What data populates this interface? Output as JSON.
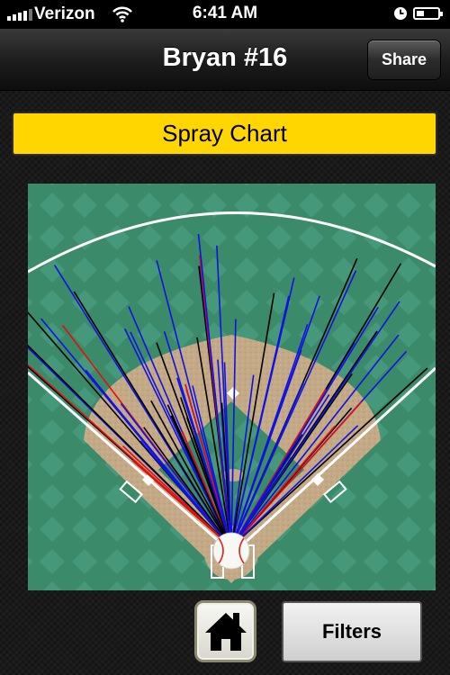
{
  "status_bar": {
    "carrier": "Verizon",
    "time": "6:41 AM",
    "signal_icon": "signal-bars-icon",
    "wifi_icon": "wifi-icon",
    "alarm_icon": "alarm-clock-icon",
    "battery_icon": "battery-icon",
    "battery_level": 0.35
  },
  "nav": {
    "title": "Bryan #16",
    "share_label": "Share"
  },
  "banner": {
    "title": "Spray Chart"
  },
  "field": {
    "grass_color": "#3b8a6a",
    "dirt_color": "#c3a986",
    "line_color": "#ffffff"
  },
  "spray_chart": {
    "legend_colors": {
      "blue": "#1212e0",
      "black": "#000000",
      "red": "#e01010"
    },
    "hit_count": 72
  },
  "bottom_bar": {
    "home_icon": "home-icon",
    "filters_label": "Filters"
  }
}
